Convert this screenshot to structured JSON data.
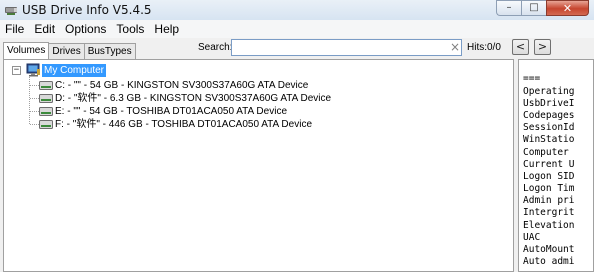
{
  "window": {
    "title": "USB Drive Info V5.4.5",
    "caption": {
      "minimize": "–",
      "maximize": "□",
      "close": "✕"
    }
  },
  "menu": [
    "File",
    "Edit",
    "Options",
    "Tools",
    "Help"
  ],
  "tabs": [
    {
      "label": "Volumes",
      "active": true
    },
    {
      "label": "Drives",
      "active": false
    },
    {
      "label": "BusTypes",
      "active": false
    }
  ],
  "search": {
    "label": "Search:",
    "value": "",
    "clear_glyph": "×",
    "hits_label": "Hits:",
    "hits_value": "0/0",
    "prev": "<",
    "next": ">"
  },
  "tree": {
    "root": {
      "label": "My Computer",
      "expanded_glyph": "−",
      "icon": "computer-icon"
    },
    "drives": [
      {
        "label": "C: - \"\" - 54 GB - KINGSTON SV300S37A60G ATA Device",
        "icon": "drive-icon"
      },
      {
        "label": "D: - \"软件\" - 6.3 GB - KINGSTON SV300S37A60G ATA Device",
        "icon": "drive-icon"
      },
      {
        "label": "E: - \"\" - 54 GB - TOSHIBA DT01ACA050 ATA Device",
        "icon": "drive-icon"
      },
      {
        "label": "F: - \"软件\" - 446 GB - TOSHIBA DT01ACA050 ATA Device",
        "icon": "drive-icon"
      }
    ]
  },
  "info_panel": {
    "lines": [
      "          ===",
      "Operating",
      "UsbDriveI",
      "Codepages",
      "SessionId",
      "WinStatio",
      "Computer",
      "Current U",
      "Logon SID",
      "Logon Tim",
      "Admin pri",
      "Intergrit",
      "Elevation",
      "UAC",
      "AutoMount",
      "Auto admi"
    ]
  },
  "colors": {
    "selection": "#3399ff",
    "titlebar": "#dbe6f3",
    "close": "#c6452f"
  }
}
